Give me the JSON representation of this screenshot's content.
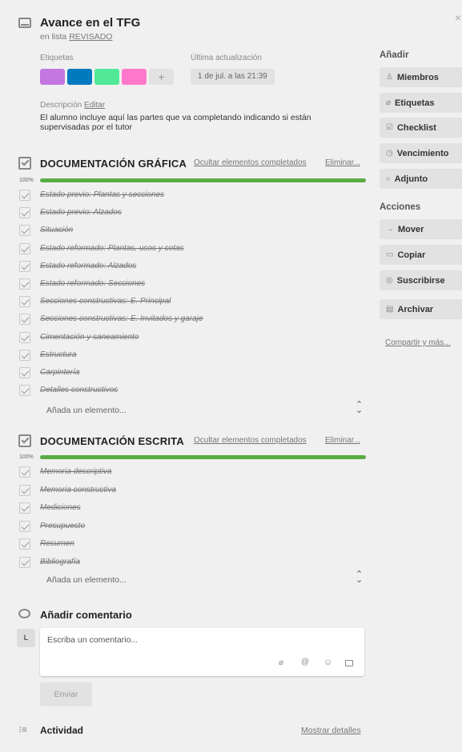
{
  "header": {
    "title": "Avance en el TFG",
    "in_list_prefix": "en lista",
    "list_name": "REVISADO",
    "close": "×"
  },
  "labels": {
    "heading": "Etiquetas",
    "colors": [
      "#c377e0",
      "#0079bf",
      "#51e898",
      "#ff78cb"
    ],
    "add": "+"
  },
  "updated": {
    "heading": "Última actualización",
    "value": "1 de jul. a las 21:39"
  },
  "description": {
    "heading": "Descripción",
    "edit": "Editar",
    "text": "El alumno incluye aquí las partes que va completando indicando si están supervisadas por el tutor"
  },
  "checklists": [
    {
      "title": "DOCUMENTACIÓN GRÁFICA",
      "hide_completed": "Ocultar elementos completados",
      "delete": "Eliminar...",
      "percent": "100%",
      "progress": 1.0,
      "items": [
        "Estado previo: Plantas y secciones",
        "Estado previo: Alzados",
        "Situación",
        "Estado reformado: Plantas, usos y cotas",
        "Estado reformado: Alzados",
        "Estado reformado: Secciones",
        "Secciones constructivas: E. Principal",
        "Secciones constructivas: E. Invitados y garaje",
        "Cimentación y saneamiento",
        "Estructura",
        "Carpintería",
        "Detalles constructivos"
      ],
      "add_item": "Añada un elemento..."
    },
    {
      "title": "DOCUMENTACIÓN ESCRITA",
      "hide_completed": "Ocultar elementos completados",
      "delete": "Eliminar...",
      "percent": "100%",
      "progress": 1.0,
      "items": [
        "Memoria descriptiva",
        "Memoria constructiva",
        "Mediciones",
        "Presupuesto",
        "Resumen",
        "Bibliografía"
      ],
      "add_item": "Añada un elemento..."
    }
  ],
  "comment": {
    "heading": "Añadir comentario",
    "avatar": "L",
    "placeholder": "Escriba un comentario...",
    "send": "Enviar"
  },
  "activity": {
    "heading": "Actividad",
    "show_details": "Mostrar detalles"
  },
  "sidebar": {
    "add_heading": "Añadir",
    "add_buttons": [
      {
        "icon": "person-icon",
        "glyph": "♙",
        "label": "Miembros"
      },
      {
        "icon": "tag-icon",
        "glyph": "⌀",
        "label": "Etiquetas"
      },
      {
        "icon": "checklist-icon",
        "glyph": "☑",
        "label": "Checklist"
      },
      {
        "icon": "clock-icon",
        "glyph": "◷",
        "label": "Vencimiento"
      },
      {
        "icon": "paperclip-icon",
        "glyph": "⌕",
        "label": "Adjunto"
      }
    ],
    "actions_heading": "Acciones",
    "action_buttons": [
      {
        "icon": "arrow-right-icon",
        "glyph": "→",
        "label": "Mover"
      },
      {
        "icon": "card-icon",
        "glyph": "▭",
        "label": "Copiar"
      },
      {
        "icon": "eye-icon",
        "glyph": "◎",
        "label": "Suscribirse"
      },
      {
        "icon": "archive-icon",
        "glyph": "▤",
        "label": "Archivar"
      }
    ],
    "share": "Compartir y más..."
  }
}
